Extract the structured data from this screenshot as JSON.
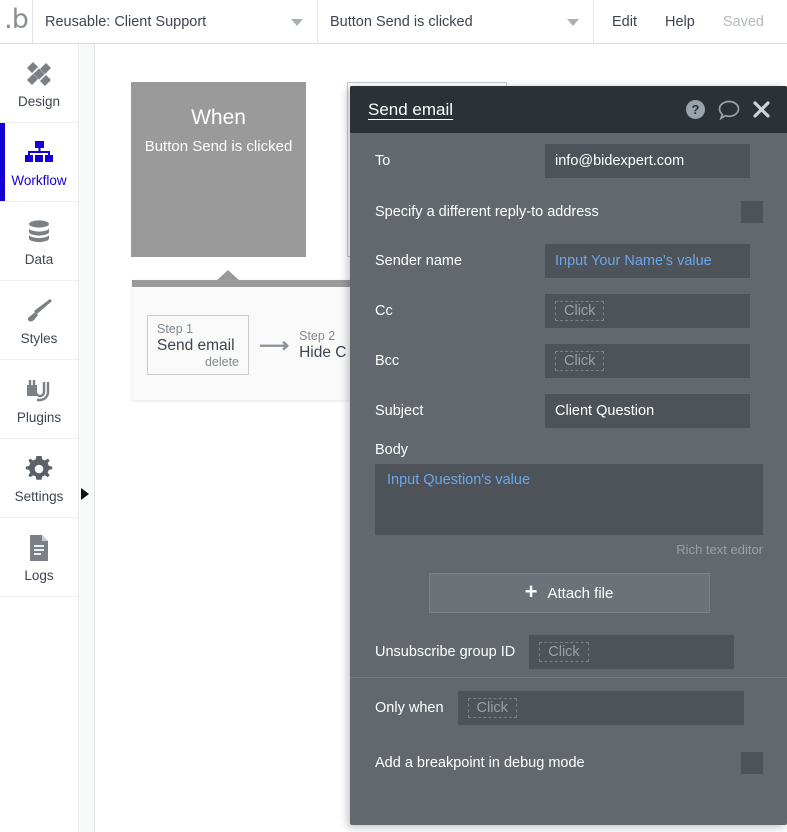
{
  "topbar": {
    "logo": "bubble-logo-icon",
    "page_selector": {
      "value": "Reusable: Client Support",
      "caret": "chevron-down-icon"
    },
    "workflow_selector": {
      "value": "Button Send is clicked",
      "caret": "chevron-down-icon"
    },
    "edit_label": "Edit",
    "help_label": "Help",
    "saved_label": "Saved"
  },
  "sidebar": {
    "active_color": "#1400d4",
    "items": [
      {
        "label": "Design",
        "icon": "design-icon"
      },
      {
        "label": "Workflow",
        "icon": "workflow-icon"
      },
      {
        "label": "Data",
        "icon": "data-icon"
      },
      {
        "label": "Styles",
        "icon": "styles-icon"
      },
      {
        "label": "Plugins",
        "icon": "plugins-icon"
      },
      {
        "label": "Settings",
        "icon": "gear-icon"
      },
      {
        "label": "Logs",
        "icon": "logs-icon"
      }
    ]
  },
  "canvas": {
    "event_block": {
      "title": "When",
      "subtitle": "Button Send is clicked",
      "color": "#9a9a9a"
    },
    "steps": [
      {
        "number": "Step 1",
        "name": "Send email",
        "action": "delete"
      },
      {
        "number": "Step 2",
        "name": "Hide C"
      }
    ],
    "step_arrow": "arrow-right-icon"
  },
  "dialog": {
    "title": "Send email",
    "icons": {
      "help": "help-circle-icon",
      "comment": "speech-bubble-icon",
      "close": "close-icon"
    },
    "header_color": "#2b3137",
    "body_color": "#62686d",
    "field_color": "#4e5359",
    "expression_color": "#6aa7e8",
    "fields": {
      "to": {
        "label": "To",
        "value": "info@bidexpert.com"
      },
      "reply_to": {
        "label": "Specify a different reply-to address",
        "checked": false
      },
      "sender_name": {
        "label": "Sender name",
        "value": "Input Your Name's value",
        "is_expression": true
      },
      "cc": {
        "label": "Cc",
        "placeholder": "Click",
        "value": ""
      },
      "bcc": {
        "label": "Bcc",
        "placeholder": "Click",
        "value": ""
      },
      "subject": {
        "label": "Subject",
        "value": "Client Question"
      },
      "body": {
        "label": "Body",
        "value": "Input Question's value",
        "is_expression": true,
        "note": "Rich text editor"
      },
      "attach": {
        "label": "Attach file",
        "icon": "plus-icon"
      },
      "unsubscribe": {
        "label": "Unsubscribe group ID",
        "placeholder": "Click",
        "value": ""
      },
      "only_when": {
        "label": "Only when",
        "placeholder": "Click",
        "value": ""
      },
      "breakpoint": {
        "label": "Add a breakpoint in debug mode",
        "checked": false
      }
    }
  }
}
